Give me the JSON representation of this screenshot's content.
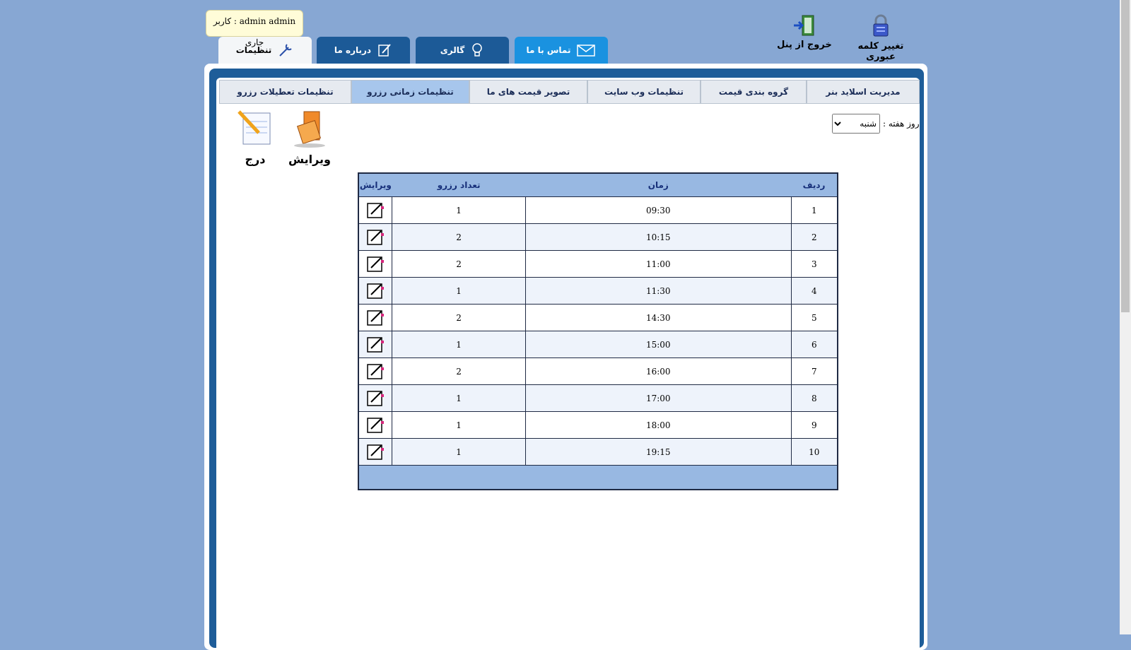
{
  "header": {
    "current_user": "admin admin : کاربر جاری",
    "change_password": "تغییر کلمه عبوری",
    "logout": "خروج از پنل"
  },
  "main_tabs": [
    {
      "label": "تنظیمات",
      "icon": "tools-icon",
      "active": true
    },
    {
      "label": "درباره ما",
      "icon": "notepad-pen-icon"
    },
    {
      "label": "گالری",
      "icon": "lightbulb-icon"
    },
    {
      "label": "تماس با ما",
      "icon": "envelope-icon"
    }
  ],
  "sub_tabs": [
    {
      "label": "مدیریت اسلاید بنر"
    },
    {
      "label": "گروه بندی قیمت"
    },
    {
      "label": "تنظیمات وب سایت"
    },
    {
      "label": "تصویر قیمت های ما"
    },
    {
      "label": "تنظیمات زمانی رزرو",
      "active": true
    },
    {
      "label": "تنظیمات تعطیلات رزرو"
    }
  ],
  "filter": {
    "day_label": "روز هفته :",
    "day_value": "شنبه"
  },
  "actions": {
    "edit": "ویرایش",
    "insert": "درج"
  },
  "table": {
    "headers": {
      "row": "ردیف",
      "time": "زمان",
      "count": "تعداد رزرو",
      "edit": "ویرایش"
    },
    "rows": [
      {
        "row": "1",
        "time": "09:30",
        "count": "1"
      },
      {
        "row": "2",
        "time": "10:15",
        "count": "2"
      },
      {
        "row": "3",
        "time": "11:00",
        "count": "2"
      },
      {
        "row": "4",
        "time": "11:30",
        "count": "1"
      },
      {
        "row": "5",
        "time": "14:30",
        "count": "2"
      },
      {
        "row": "6",
        "time": "15:00",
        "count": "1"
      },
      {
        "row": "7",
        "time": "16:00",
        "count": "2"
      },
      {
        "row": "8",
        "time": "17:00",
        "count": "1"
      },
      {
        "row": "9",
        "time": "18:00",
        "count": "1"
      },
      {
        "row": "10",
        "time": "19:15",
        "count": "1"
      }
    ]
  },
  "colors": {
    "background": "#87a7d3",
    "frame": "#1e5d99",
    "tab_dark": "#1c5a97",
    "tab_contact": "#1a92e0",
    "header_row": "#98b8e2"
  }
}
